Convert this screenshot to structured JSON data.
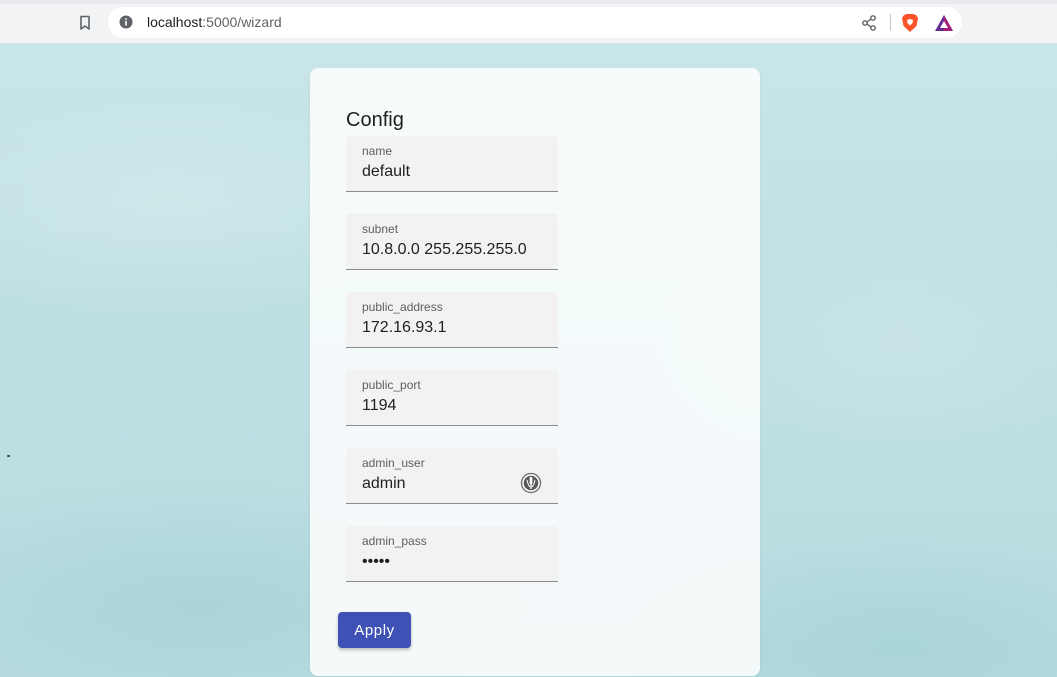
{
  "browser": {
    "url_host": "localhost",
    "url_path": ":5000/wizard",
    "icons": {
      "bookmark": "bookmark-icon",
      "info": "info-icon",
      "share": "share-icon",
      "brave": "brave-shields-icon",
      "rewards": "brave-rewards-icon"
    }
  },
  "form": {
    "title": "Config",
    "fields": [
      {
        "label": "name",
        "value": "default"
      },
      {
        "label": "subnet",
        "value": "10.8.0.0 255.255.255.0"
      },
      {
        "label": "public_address",
        "value": "172.16.93.1"
      },
      {
        "label": "public_port",
        "value": "1194"
      },
      {
        "label": "admin_user",
        "value": "admin",
        "icon": "password-manager-key-icon"
      },
      {
        "label": "admin_pass",
        "value": "admin",
        "type": "password"
      }
    ],
    "apply_label": "Apply"
  },
  "colors": {
    "accent": "#3f51b5",
    "background": "#c4e3e6"
  }
}
